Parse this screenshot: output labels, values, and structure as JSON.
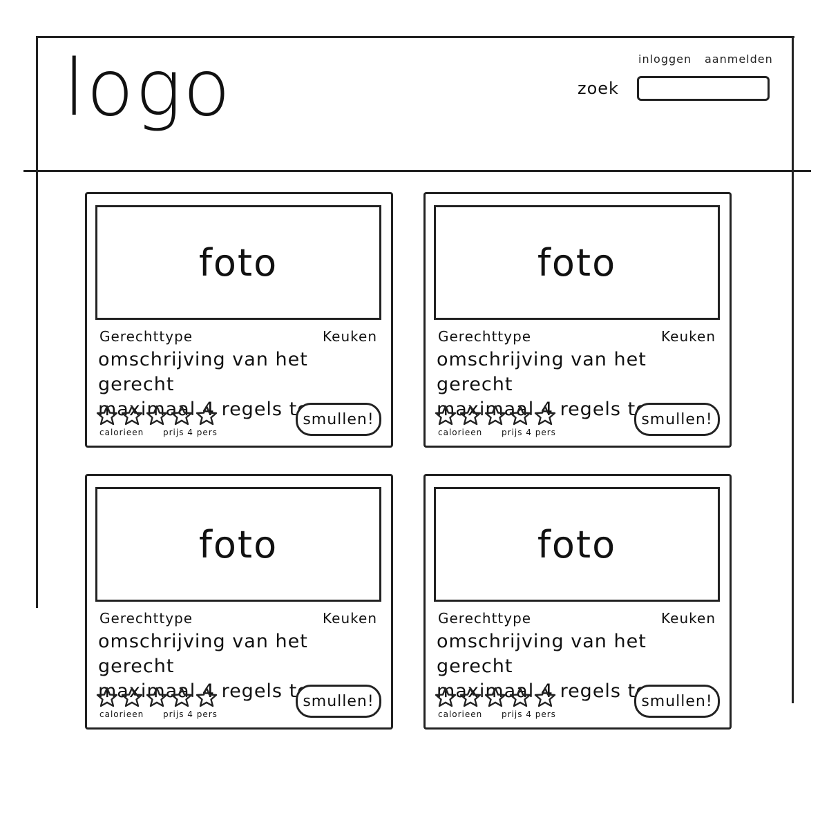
{
  "header": {
    "logo": "logo",
    "login": "inloggen",
    "signup": "aanmelden",
    "search_label": "zoek",
    "search_value": ""
  },
  "cards": [
    {
      "photo": "foto",
      "dish_type": "Gerechttype",
      "cuisine": "Keuken",
      "desc_line1": "omschrijving van het gerecht",
      "desc_line2": "maximaal 4 regels tonen",
      "rating": 5,
      "calories_label": "calorieen",
      "price_label": "prijs 4 pers",
      "button": "smullen!"
    },
    {
      "photo": "foto",
      "dish_type": "Gerechttype",
      "cuisine": "Keuken",
      "desc_line1": "omschrijving van het gerecht",
      "desc_line2": "maximaal 4 regels tonen",
      "rating": 5,
      "calories_label": "calorieen",
      "price_label": "prijs 4 pers",
      "button": "smullen!"
    },
    {
      "photo": "foto",
      "dish_type": "Gerechttype",
      "cuisine": "Keuken",
      "desc_line1": "omschrijving van het gerecht",
      "desc_line2": "maximaal 4 regels tonen",
      "rating": 5,
      "calories_label": "calorieen",
      "price_label": "prijs 4 pers",
      "button": "smullen!"
    },
    {
      "photo": "foto",
      "dish_type": "Gerechttype",
      "cuisine": "Keuken",
      "desc_line1": "omschrijving van het gerecht",
      "desc_line2": "maximaal 4 regels tonen",
      "rating": 5,
      "calories_label": "calorieen",
      "price_label": "prijs 4 pers",
      "button": "smullen!"
    }
  ]
}
